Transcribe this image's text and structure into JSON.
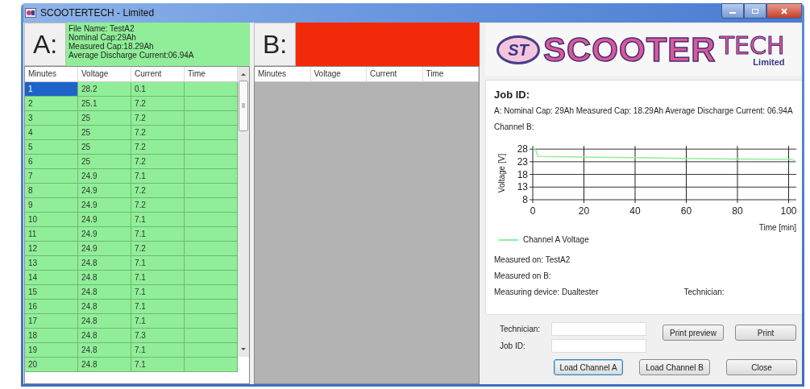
{
  "window": {
    "title": "SCOOTERTECH - Limited"
  },
  "channels": [
    {
      "label": "A:",
      "color": "#90ee98",
      "info": [
        "File Name: TestA2",
        "Nominal Cap:29Ah",
        "Measured Cap:18.29Ah",
        "Average Discharge Current:06.94A"
      ],
      "columns": [
        "Minutes",
        "Voltage",
        "Current",
        "Time"
      ],
      "rows": [
        {
          "cells": [
            "1",
            "28.2",
            "0.1",
            ""
          ],
          "selected": true
        },
        {
          "cells": [
            "2",
            "25.1",
            "7.2",
            ""
          ],
          "selected": false
        },
        {
          "cells": [
            "3",
            "25",
            "7.2",
            ""
          ],
          "selected": false
        },
        {
          "cells": [
            "4",
            "25",
            "7.2",
            ""
          ],
          "selected": false
        },
        {
          "cells": [
            "5",
            "25",
            "7.2",
            ""
          ],
          "selected": false
        },
        {
          "cells": [
            "6",
            "25",
            "7.2",
            ""
          ],
          "selected": false
        },
        {
          "cells": [
            "7",
            "24.9",
            "7.1",
            ""
          ],
          "selected": false
        },
        {
          "cells": [
            "8",
            "24.9",
            "7.2",
            ""
          ],
          "selected": false
        },
        {
          "cells": [
            "9",
            "24.9",
            "7.2",
            ""
          ],
          "selected": false
        },
        {
          "cells": [
            "10",
            "24.9",
            "7.1",
            ""
          ],
          "selected": false
        },
        {
          "cells": [
            "11",
            "24.9",
            "7.1",
            ""
          ],
          "selected": false
        },
        {
          "cells": [
            "12",
            "24.9",
            "7.2",
            ""
          ],
          "selected": false
        },
        {
          "cells": [
            "13",
            "24.8",
            "7.1",
            ""
          ],
          "selected": false
        },
        {
          "cells": [
            "14",
            "24.8",
            "7.1",
            ""
          ],
          "selected": false
        },
        {
          "cells": [
            "15",
            "24.8",
            "7.1",
            ""
          ],
          "selected": false
        },
        {
          "cells": [
            "16",
            "24.8",
            "7.1",
            ""
          ],
          "selected": false
        },
        {
          "cells": [
            "17",
            "24.8",
            "7.1",
            ""
          ],
          "selected": false
        },
        {
          "cells": [
            "18",
            "24.8",
            "7.3",
            ""
          ],
          "selected": false
        },
        {
          "cells": [
            "19",
            "24.8",
            "7.1",
            ""
          ],
          "selected": false
        },
        {
          "cells": [
            "20",
            "24.8",
            "7.1",
            ""
          ],
          "selected": false
        }
      ]
    },
    {
      "label": "B:",
      "color": "#f22a0a",
      "columns": [
        "Minutes",
        "Voltage",
        "Current",
        "Time"
      ]
    }
  ],
  "logo": {
    "emblem": "ST",
    "name": "SCOOTER",
    "name2": "TECH",
    "sub": "Limited"
  },
  "report": {
    "job_id": "Job ID:",
    "summary": "A: Nominal Cap: 29Ah Measured Cap: 18.29Ah Average Discharge Current: 06.94A",
    "channel_b": "Channel B:",
    "chart_data": {
      "type": "line",
      "grid": true,
      "xlabel": "Time [min]",
      "ylabel": "Voltage [V]",
      "xlim": [
        0,
        103
      ],
      "ylim": [
        8,
        29
      ],
      "xticks": [
        0,
        20,
        40,
        60,
        80,
        100
      ],
      "yticks": [
        8,
        13,
        18,
        23,
        28
      ],
      "x": [
        0,
        1,
        2,
        20,
        40,
        60,
        80,
        100,
        101,
        103
      ],
      "series": [
        {
          "name": "Channel A Voltage",
          "color": "#90ee98",
          "values": [
            28.2,
            28.2,
            25.1,
            24.9,
            24.6,
            24.3,
            24.1,
            24.0,
            24.0,
            23.0
          ]
        }
      ]
    },
    "measured_a": "Measured on: TestA2",
    "measured_b": "Measured on B:",
    "device": "Measuring device: Dualtester",
    "technician": "Technician:"
  },
  "form": [
    {
      "label": "Technician:"
    },
    {
      "label": "Job ID:"
    }
  ],
  "buttons": [
    {
      "label": "Print preview",
      "kind": "print_preview",
      "focused": false
    },
    {
      "label": "Print",
      "kind": "print",
      "focused": false
    },
    {
      "label": "Load Channel A",
      "kind": "load_a",
      "focused": true
    },
    {
      "label": "Load Channel B",
      "kind": "load_b",
      "focused": false
    },
    {
      "label": "Close",
      "kind": "close",
      "focused": false
    }
  ]
}
